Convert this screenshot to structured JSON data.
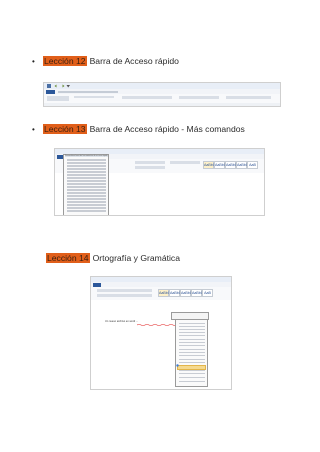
{
  "sections": [
    {
      "bullet": "•",
      "lesson": "Lección 12",
      "title": "Barra de Acceso rápido"
    },
    {
      "bullet": "•",
      "lesson": "Lección 13",
      "title": "Barra de Acceso rápido - Más comandos"
    },
    {
      "bullet": "",
      "lesson": "Lección 14",
      "title": "Ortografía y Gramática"
    }
  ],
  "colors": {
    "lesson_highlight": "#e15f1a",
    "ribbon_blue": "#2b579a",
    "selected_menu": "#f5d98e"
  },
  "icons": [
    "save-icon",
    "undo-icon",
    "redo-icon",
    "customize-toolbar-icon",
    "spelling-check-icon"
  ],
  "screenshot_text": {
    "tab_file": "Archivo",
    "tab_home": "Inicio",
    "tab_insert": "Insertar",
    "style_normal": "AaBbCcDc",
    "style_heading": "AaB",
    "menu_title": "Personalizar barra de herramientas de acceso rápido",
    "doc_text": "Un  nuevo archivo  en  word  ..."
  }
}
